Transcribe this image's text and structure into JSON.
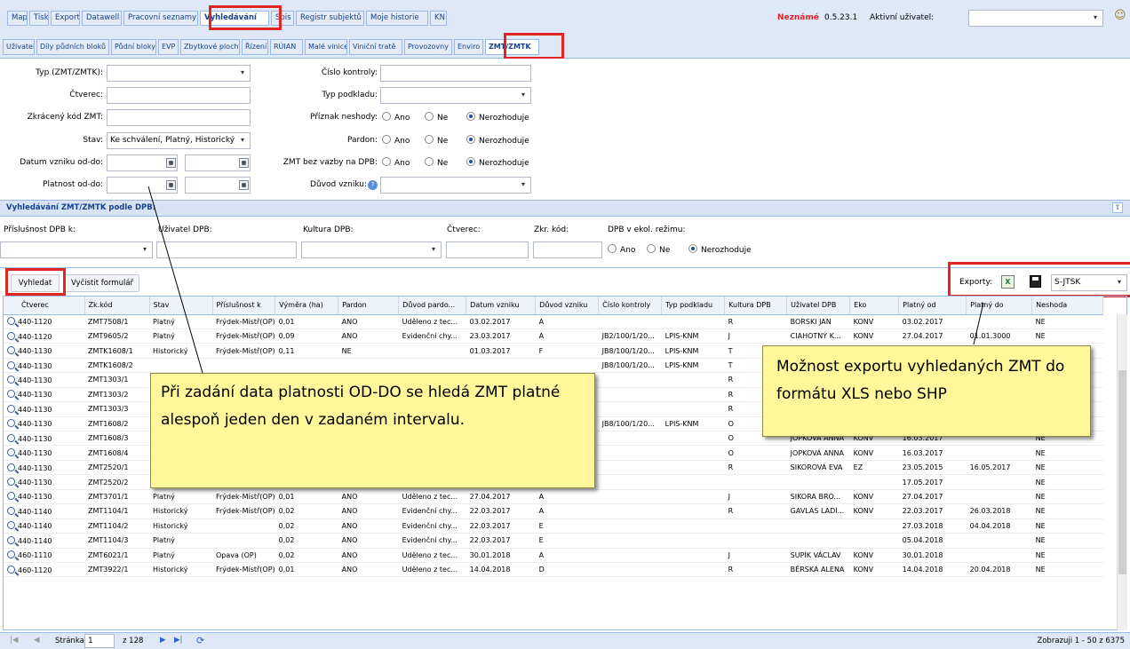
{
  "top_tabs": [
    "Mapa",
    "Tisky",
    "Exporty",
    "Datawell",
    "Pracovní seznamy",
    "Vyhledávání",
    "Spis",
    "Registr subjektů",
    "Moje historie",
    "KN"
  ],
  "status": {
    "unknown": "Neznámé",
    "version": "0.5.23.1",
    "user_label": "Aktivní uživatel:"
  },
  "sub_tabs": [
    "Uživatel",
    "Díly půdních bloků",
    "Půdní bloky",
    "EVP",
    "Zbytkové plochy",
    "Řízení",
    "RÚIAN",
    "Malé vinice",
    "Viniční tratě",
    "Provozovny",
    "Enviro",
    "ZMT/ZMTK"
  ],
  "form": {
    "typ_label": "Typ (ZMT/ZMTK):",
    "ctverec_label": "Čtverec:",
    "kod_label": "Zkrácený kód ZMT:",
    "stav_label": "Stav:",
    "stav_value": "Ke schválení, Platný, Historický",
    "datum_label": "Datum vzniku od-do:",
    "platnost_label": "Platnost od-do:",
    "cislo_label": "Číslo kontroly:",
    "podklad_label": "Typ podkladu:",
    "priznak_label": "Příznak neshody:",
    "pardon_label": "Pardon:",
    "vazba_label": "ZMT bez vazby na DPB:",
    "duvod_label": "Důvod vzniku:",
    "ano": "Ano",
    "ne": "Ne",
    "nerozhoduje": "Nerozhoduje"
  },
  "section": {
    "title": "Vyhledávání ZMT/ZMTK podle DPB:",
    "prislusnost": "Příslušnost DPB k:",
    "uzivatel": "Uživatel DPB:",
    "kultura": "Kultura DPB:",
    "ctverec": "Čtverec:",
    "zkr": "Zkr. kód:",
    "ekol": "DPB v ekol. režimu:"
  },
  "toolbar": {
    "search": "Vyhledat",
    "clear": "Vyčistit formulář",
    "exports": "Exporty:",
    "select": "S-JTSK"
  },
  "columns": [
    "Čtverec",
    "Zk.kód",
    "Stav",
    "Příslušnost k",
    "Výměra (ha)",
    "Pardon",
    "Důvod pardo...",
    "Datum vzniku",
    "Důvod vzniku",
    "Číslo kontroly",
    "Typ podkladu",
    "Kultura DPB",
    "Uživatel DPB",
    "Eko",
    "Platný od",
    "Platný do",
    "Neshoda"
  ],
  "rows": [
    [
      "440-1120",
      "ZMT7508/1",
      "Platný",
      "Frýdek-Místř(OP)",
      "0,01",
      "ANO",
      "Uděleno z tec...",
      "03.02.2017",
      "A",
      "",
      "",
      "R",
      "BORSKI JAN",
      "KONV",
      "03.02.2017",
      "",
      "NE"
    ],
    [
      "440-1120",
      "ZMT9605/2",
      "Platný",
      "Frýdek-Místř(OP)",
      "0,09",
      "ANO",
      "Evidenční chy...",
      "23.03.2017",
      "A",
      "JB2/100/1/20...",
      "LPIS-KNM",
      "J",
      "CIAHOTNÝ K...",
      "KONV",
      "27.04.2017",
      "01.01.3000",
      "NE"
    ],
    [
      "440-1130",
      "ZMTK1608/1",
      "Historický",
      "Frýdek-Místř(OP)",
      "0,11",
      "NE",
      "",
      "01.03.2017",
      "F",
      "JB8/100/1/20...",
      "LPIS-KNM",
      "T",
      "",
      "",
      "",
      "",
      "NE"
    ],
    [
      "440-1130",
      "ZMTK1608/2",
      "",
      "",
      "",
      "",
      "",
      "",
      "",
      "JB8/100/1/20...",
      "LPIS-KNM",
      "T",
      "",
      "",
      "",
      "",
      "NE"
    ],
    [
      "440-1130",
      "ZMT1303/1",
      "",
      "",
      "",
      "",
      "",
      "",
      "",
      "",
      "",
      "R",
      "",
      "",
      "",
      "",
      "NE"
    ],
    [
      "440-1130",
      "ZMT1303/2",
      "",
      "",
      "",
      "",
      "",
      "",
      "",
      "",
      "",
      "R",
      "",
      "",
      "",
      "",
      "NE"
    ],
    [
      "440-1130",
      "ZMT1303/3",
      "",
      "",
      "",
      "",
      "",
      "",
      "",
      "",
      "",
      "R",
      "",
      "",
      "",
      "",
      "NE"
    ],
    [
      "440-1130",
      "ZMT1608/2",
      "",
      "",
      "",
      "",
      "",
      "",
      "",
      "JB8/100/1/20...",
      "LPIS-KNM",
      "O",
      "JOPKOVÁ ANNA",
      "KONV",
      "16.03.2017",
      "",
      "NE"
    ],
    [
      "440-1130",
      "ZMT1608/3",
      "",
      "",
      "",
      "",
      "",
      "",
      "",
      "",
      "",
      "O",
      "JOPKOVÁ ANNA",
      "KONV",
      "16.03.2017",
      "",
      "NE"
    ],
    [
      "440-1130",
      "ZMT1608/4",
      "",
      "",
      "",
      "",
      "",
      "",
      "",
      "",
      "",
      "O",
      "JOPKOVÁ ANNA",
      "KONV",
      "16.03.2017",
      "",
      "NE"
    ],
    [
      "440-1130",
      "ZMT2520/1",
      "Historický",
      "Frýdek-Místř(OP)",
      "0,16",
      "NE",
      "",
      "23.05.2015",
      "A",
      "",
      "",
      "R",
      "SIKOROVÁ EVA",
      "EZ",
      "23.05.2015",
      "16.05.2017",
      "NE"
    ],
    [
      "440-1130",
      "ZMT2520/2",
      "Platný",
      "",
      "0,16",
      "NE",
      "",
      "23.05.2015",
      "E",
      "",
      "",
      "",
      "",
      "",
      "17.05.2017",
      "",
      "NE"
    ],
    [
      "440-1130",
      "ZMT3701/1",
      "Platný",
      "Frýdek-Místř(OP)",
      "0,01",
      "ANO",
      "Uděleno z tec...",
      "27.04.2017",
      "A",
      "",
      "",
      "J",
      "SIKORA BRO...",
      "KONV",
      "27.04.2017",
      "",
      "NE"
    ],
    [
      "440-1140",
      "ZMT1104/1",
      "Historický",
      "Frýdek-Místř(OP)",
      "0,02",
      "ANO",
      "Evidenční chy...",
      "22.03.2017",
      "A",
      "",
      "",
      "R",
      "GAVLAS LADI...",
      "KONV",
      "22.03.2017",
      "26.03.2018",
      "NE"
    ],
    [
      "440-1140",
      "ZMT1104/2",
      "Historický",
      "",
      "0,02",
      "ANO",
      "Evidenční chy...",
      "22.03.2017",
      "E",
      "",
      "",
      "",
      "",
      "",
      "27.03.2018",
      "04.04.2018",
      "NE"
    ],
    [
      "440-1140",
      "ZMT1104/3",
      "Platný",
      "",
      "0,02",
      "ANO",
      "Evidenční chy...",
      "22.03.2017",
      "E",
      "",
      "",
      "",
      "",
      "",
      "05.04.2018",
      "",
      "NE"
    ],
    [
      "460-1110",
      "ZMT6021/1",
      "Platný",
      "Opava (OP)",
      "0,02",
      "ANO",
      "Uděleno z tec...",
      "30.01.2018",
      "A",
      "",
      "",
      "J",
      "SUPÍK VÁCLAV",
      "KONV",
      "30.01.2018",
      "",
      "NE"
    ],
    [
      "460-1120",
      "ZMT3922/1",
      "Historický",
      "Frýdek-Místř(OP)",
      "0,01",
      "ANO",
      "Uděleno z tec...",
      "14.04.2018",
      "D",
      "",
      "",
      "R",
      "BĚRSKÁ ALENA",
      "KONV",
      "14.04.2018",
      "20.04.2018",
      "NE"
    ]
  ],
  "pager": {
    "page_label": "Stránka",
    "page": "1",
    "of": "z 128",
    "summary": "Zobrazuji 1 - 50 z 6375"
  },
  "callouts": {
    "left": "Při zadání data platnosti OD-DO se hledá ZMT platné alespoň jeden den v zadaném intervalu.",
    "right": "Možnost exportu vyhledaných ZMT do formátu XLS nebo SHP"
  }
}
